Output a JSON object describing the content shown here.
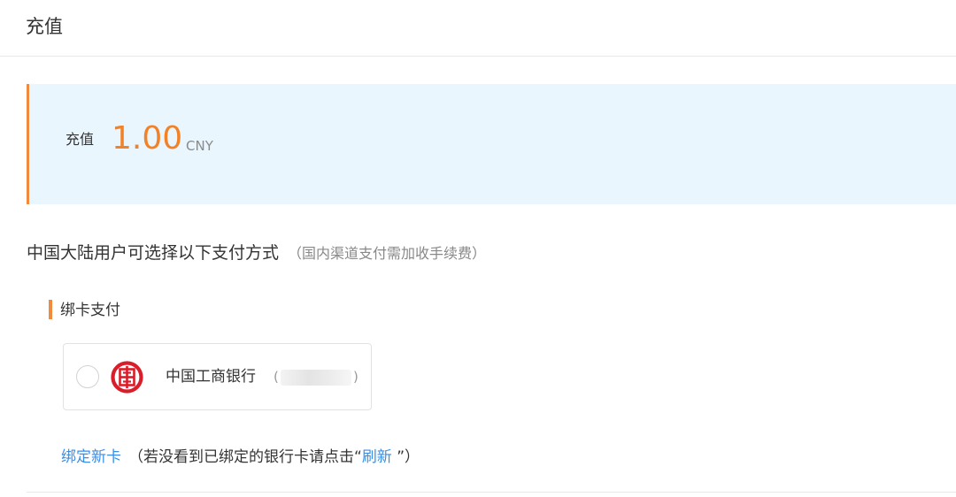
{
  "header": {
    "title": "充值"
  },
  "amount": {
    "label": "充值",
    "value": "1.00",
    "currency": "CNY"
  },
  "methods": {
    "heading": "中国大陆用户可选择以下支付方式",
    "note": "（国内渠道支付需加收手续费）"
  },
  "card_payment": {
    "section_title": "绑卡支付",
    "bank": {
      "name": "中国工商银行",
      "paren_open": "(",
      "paren_close": ")",
      "logo_icon": "icbc-logo-icon",
      "selected": false
    }
  },
  "bind": {
    "link_label": "绑定新卡",
    "hint_before": "（若没看到已绑定的银行卡请点击“",
    "refresh_label": "刷新",
    "hint_after": " ”）"
  },
  "colors": {
    "accent_orange": "#f08a3c",
    "amount_orange": "#f28228",
    "panel_bg": "#eaf6fe",
    "link_blue": "#3a8ee6",
    "icbc_red": "#d81e2a"
  }
}
